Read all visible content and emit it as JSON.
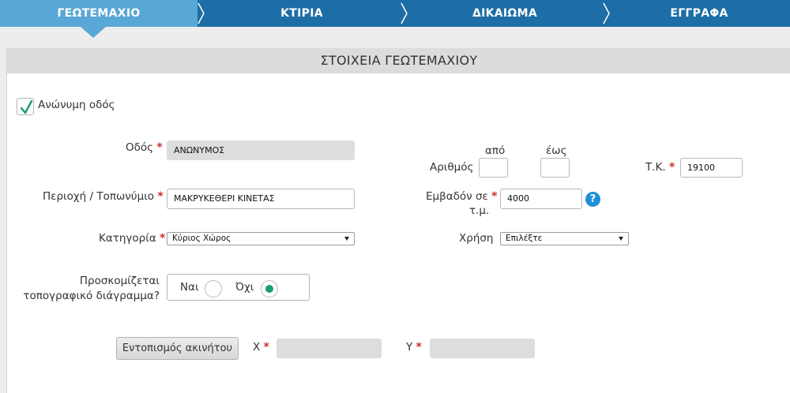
{
  "tabs": [
    {
      "label": "ΓΕΩΤΕΜΑΧΙΟ"
    },
    {
      "label": "ΚΤΙΡΙΑ"
    },
    {
      "label": "ΔΙΚΑΙΩΜΑ"
    },
    {
      "label": "ΕΓΓΡΑΦΑ"
    }
  ],
  "section_title": "ΣΤΟΙΧΕΙΑ ΓΕΩΤΕΜΑΧΙΟΥ",
  "anonymous_street": {
    "label": "Ανώνυμη οδός",
    "checked": true
  },
  "street": {
    "label": "Οδός",
    "value": "ΑΝΩΝΥΜΟΣ"
  },
  "area": {
    "label": "Περιοχή / Τοπωνύμιο",
    "value": "ΜΑΚΡΥΚΕΘΕΡΙ ΚΙΝΕΤΑΣ"
  },
  "category": {
    "label": "Κατηγορία",
    "value": "Κύριος Χώρος"
  },
  "number": {
    "label": "Αριθμός",
    "from_label": "από",
    "to_label": "έως",
    "from_value": "",
    "to_value": ""
  },
  "postal_code": {
    "label": "Τ.Κ.",
    "value": "19100"
  },
  "surface": {
    "label_line1": "Εμβαδόν σε",
    "label_line2": "τ.μ.",
    "value": "4000"
  },
  "usage": {
    "label": "Χρήση",
    "value": "Επιλέξτε"
  },
  "topographic": {
    "label_line1": "Προσκομίζεται",
    "label_line2": "τοπογραφικό διάγραμμα?",
    "yes_label": "Ναι",
    "no_label": "Όχι",
    "selected": "Όχι"
  },
  "locate_button": {
    "label": "Εντοπισμός ακινήτου"
  },
  "x_coord": {
    "label": "X",
    "value": ""
  },
  "y_coord": {
    "label": "Y",
    "value": ""
  },
  "required_mark": "*",
  "colors": {
    "tab_bar": "#1d6ea6",
    "active_tab": "#59a7d6",
    "required": "#c9302c",
    "radio_selected": "#1a9a78",
    "help": "#1f8fd6"
  },
  "icons": {
    "checkbox": "checkmark-icon",
    "help": "help-icon",
    "dropdown": "caret-down-icon",
    "separator": "chevron-right-icon"
  }
}
